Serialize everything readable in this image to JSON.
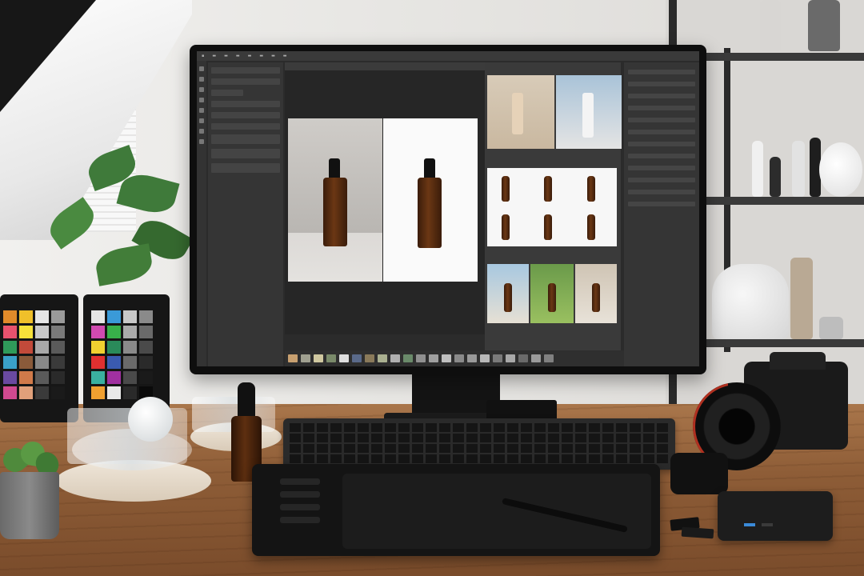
{
  "scene": {
    "description_tags": [
      "desk",
      "monitor",
      "keyboard",
      "drawing-tablet",
      "camera",
      "color-checker",
      "serum-bottles",
      "shelf"
    ],
    "colors": {
      "desk_wood": "#8e5d37",
      "wall": "#e7e6e3",
      "screen_ui": "#2b2b2b",
      "bottle_amber": "#5e2f10"
    }
  },
  "screen": {
    "menu_items": [
      "",
      "",
      "",
      "",
      "",
      "",
      "",
      "",
      ""
    ]
  },
  "color_checker": {
    "left": [
      "#e08a2a",
      "#f0c02a",
      "#e6e6e6",
      "#9a9a9a",
      "#e8526e",
      "#f7e23a",
      "#c8c8c8",
      "#7a7a7a",
      "#2f9a5a",
      "#c24a3a",
      "#a8a8a8",
      "#5a5a5a",
      "#3aa0c8",
      "#8a5a3a",
      "#888888",
      "#3a3a3a",
      "#6a4aa0",
      "#d07a4a",
      "#5a5a5a",
      "#2a2a2a",
      "#d04a90",
      "#e0a07a",
      "#3a3a3a",
      "#1a1a1a"
    ],
    "right": [
      "#e6e6e6",
      "#3a9ad8",
      "#c8c8c8",
      "#8a8a8a",
      "#d04ab0",
      "#38b04a",
      "#aaaaaa",
      "#6a6a6a",
      "#f0d030",
      "#2a8a5a",
      "#8a8a8a",
      "#4a4a4a",
      "#e03030",
      "#3a5ab0",
      "#6a6a6a",
      "#2a2a2a",
      "#3ab0a0",
      "#a030a0",
      "#4a4a4a",
      "#1a1a1a",
      "#f0a030",
      "#e8e8e8",
      "#2a2a2a",
      "#0a0a0a"
    ]
  },
  "filmstrip": [
    "#c8a070",
    "#a0a090",
    "#d0c8a0",
    "#7a8a6a",
    "#e0e0e0",
    "#5a6a8a",
    "#8a7a5a",
    "#aab090",
    "#b0b0b0",
    "#6a8a6a",
    "#909090",
    "#a0a0a0",
    "#c0c0c0",
    "#8a8a8a",
    "#9a9a9a",
    "#b8b8b8",
    "#7a7a7a",
    "#a8a8a8",
    "#6a6a6a",
    "#9a9a9a",
    "#808080"
  ]
}
